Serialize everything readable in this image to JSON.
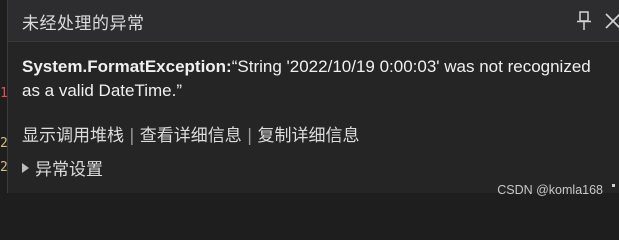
{
  "gutter": {
    "marks": [
      "1",
      "2",
      "2"
    ]
  },
  "popup": {
    "title": "未经处理的异常",
    "exception_type": "System.FormatException:",
    "exception_message": "“String '2022/10/19 0:00:03' was not recognized as a valid DateTime.”",
    "links": {
      "show_call_stack": "显示调用堆栈",
      "view_details": "查看详细信息",
      "copy_details": "复制详细信息",
      "separator": "|"
    },
    "settings_label": "异常设置"
  },
  "watermark": "CSDN @komla168",
  "icons": {
    "pin": "pin-icon",
    "close": "close-icon",
    "expand": "expand-triangle-icon"
  }
}
